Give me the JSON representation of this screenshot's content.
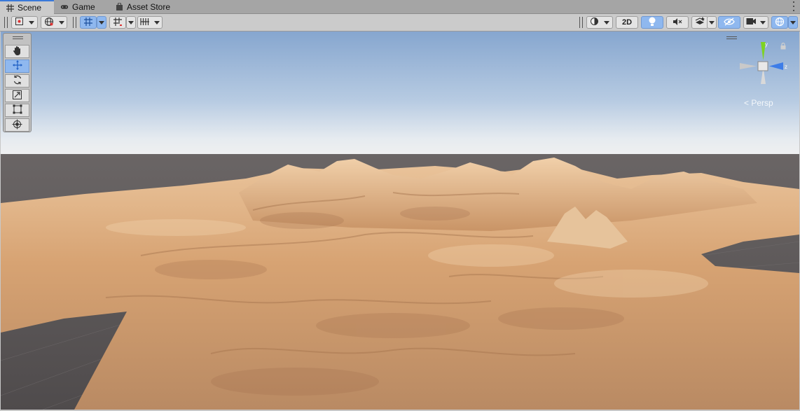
{
  "tabs": [
    {
      "label": "Scene",
      "icon": "grid-icon",
      "active": true
    },
    {
      "label": "Game",
      "icon": "gamepad-icon",
      "active": false
    },
    {
      "label": "Asset Store",
      "icon": "shopping-bag-icon",
      "active": false
    }
  ],
  "toolbar": {
    "mode_2d_label": "2D",
    "left_controls": [
      "draw-mode-icon",
      "global-icon",
      "grid-snap-icon",
      "snap-increment-icon",
      "ruler-grid-icon"
    ],
    "right_controls": [
      "shading-icon",
      "lighting-icon",
      "audio-icon",
      "effects-icon",
      "hidden-objects-icon",
      "camera-icon",
      "gizmos-icon"
    ]
  },
  "tools": [
    {
      "name": "hand-tool",
      "icon": "hand-icon",
      "active": false
    },
    {
      "name": "move-tool",
      "icon": "move-arrows-icon",
      "active": true
    },
    {
      "name": "rotate-tool",
      "icon": "rotate-icon",
      "active": false
    },
    {
      "name": "scale-tool",
      "icon": "scale-icon",
      "active": false
    },
    {
      "name": "rect-tool",
      "icon": "rect-transform-icon",
      "active": false
    },
    {
      "name": "transform-tool",
      "icon": "transform-icon",
      "active": false
    }
  ],
  "gizmo": {
    "projection_label": "< Persp",
    "axes": {
      "y": "#7ed321",
      "x": "#c9c9c9",
      "z": "#3d7de8"
    }
  },
  "colors": {
    "accent": "#3a79d9",
    "sky_top": "#8aa9cf",
    "horizon": "#e8ecef",
    "ground": "#5f5a5b",
    "terrain": "#d7a470"
  }
}
